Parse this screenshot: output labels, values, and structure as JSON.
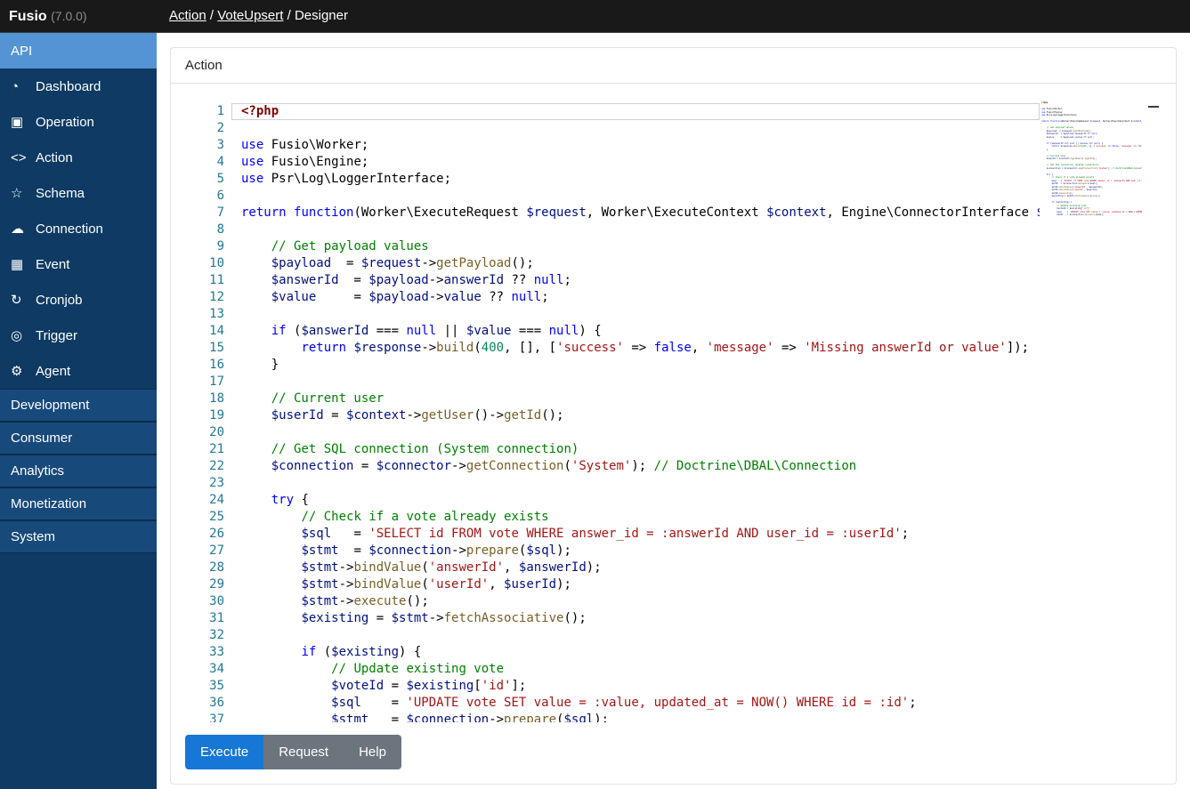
{
  "colors": {
    "c-accent": "#1677d6",
    "c-secondary": "#6c757d",
    "c-sidebar": "#0e3a63",
    "c-active": "#5494d4",
    "c-section": "#17497b"
  },
  "topbar": {
    "brand": "Fusio",
    "version": "(7.0.0)",
    "breadcrumb": [
      {
        "label": "Action",
        "link": true
      },
      {
        "label": "VoteUpsert",
        "link": true
      },
      {
        "label": "Designer",
        "link": false
      }
    ]
  },
  "sidebar": {
    "items": [
      {
        "label": "API",
        "icon": "",
        "icon_name": "",
        "active": true
      },
      {
        "label": "Dashboard",
        "icon": "◔",
        "icon_name": "dashboard-gauge-icon"
      },
      {
        "label": "Operation",
        "icon": "▣",
        "icon_name": "operation-icon"
      },
      {
        "label": "Action",
        "icon": "<>",
        "icon_name": "action-code-icon"
      },
      {
        "label": "Schema",
        "icon": "☆",
        "icon_name": "schema-star-icon"
      },
      {
        "label": "Connection",
        "icon": "☁",
        "icon_name": "connection-cloud-icon"
      },
      {
        "label": "Event",
        "icon": "▦",
        "icon_name": "event-calendar-icon"
      },
      {
        "label": "Cronjob",
        "icon": "↻",
        "icon_name": "cronjob-clock-icon"
      },
      {
        "label": "Trigger",
        "icon": "◎",
        "icon_name": "trigger-target-icon"
      },
      {
        "label": "Agent",
        "icon": "⚙",
        "icon_name": "agent-robot-icon"
      }
    ],
    "sections": [
      "Development",
      "Consumer",
      "Analytics",
      "Monetization",
      "System"
    ]
  },
  "panel": {
    "title": "Action"
  },
  "actions": {
    "execute": "Execute",
    "request": "Request",
    "help": "Help"
  },
  "editor": {
    "language": "php",
    "current_line": 1,
    "lines": [
      [
        [
          "m",
          "<?php"
        ]
      ],
      [],
      [
        [
          "k",
          "use"
        ],
        [
          "d",
          " Fusio\\Worker;"
        ]
      ],
      [
        [
          "k",
          "use"
        ],
        [
          "d",
          " Fusio\\Engine;"
        ]
      ],
      [
        [
          "k",
          "use"
        ],
        [
          "d",
          " Psr\\Log\\LoggerInterface;"
        ]
      ],
      [],
      [
        [
          "k",
          "return"
        ],
        [
          "d",
          " "
        ],
        [
          "k",
          "function"
        ],
        [
          "d",
          "(Worker\\ExecuteRequest "
        ],
        [
          "v",
          "$request"
        ],
        [
          "d",
          ", Worker\\ExecuteContext "
        ],
        [
          "v",
          "$context"
        ],
        [
          "d",
          ", Engine\\ConnectorInterface "
        ],
        [
          "v",
          "$connector"
        ],
        [
          "d",
          ", "
        ]
      ],
      [],
      [
        [
          "d",
          "    "
        ],
        [
          "c",
          "// Get payload values"
        ]
      ],
      [
        [
          "d",
          "    "
        ],
        [
          "v",
          "$payload"
        ],
        [
          "d",
          "  = "
        ],
        [
          "v",
          "$request"
        ],
        [
          "d",
          "->"
        ],
        [
          "f",
          "getPayload"
        ],
        [
          "d",
          "();"
        ]
      ],
      [
        [
          "d",
          "    "
        ],
        [
          "v",
          "$answerId"
        ],
        [
          "d",
          "  = "
        ],
        [
          "v",
          "$payload"
        ],
        [
          "d",
          "->"
        ],
        [
          "v",
          "answerId"
        ],
        [
          "d",
          " ?? "
        ],
        [
          "k",
          "null"
        ],
        [
          "d",
          ";"
        ]
      ],
      [
        [
          "d",
          "    "
        ],
        [
          "v",
          "$value"
        ],
        [
          "d",
          "     = "
        ],
        [
          "v",
          "$payload"
        ],
        [
          "d",
          "->"
        ],
        [
          "v",
          "value"
        ],
        [
          "d",
          " ?? "
        ],
        [
          "k",
          "null"
        ],
        [
          "d",
          ";"
        ]
      ],
      [],
      [
        [
          "d",
          "    "
        ],
        [
          "k",
          "if"
        ],
        [
          "d",
          " ("
        ],
        [
          "v",
          "$answerId"
        ],
        [
          "d",
          " === "
        ],
        [
          "k",
          "null"
        ],
        [
          "d",
          " || "
        ],
        [
          "v",
          "$value"
        ],
        [
          "d",
          " === "
        ],
        [
          "k",
          "null"
        ],
        [
          "d",
          ") {"
        ]
      ],
      [
        [
          "d",
          "        "
        ],
        [
          "k",
          "return"
        ],
        [
          "d",
          " "
        ],
        [
          "v",
          "$response"
        ],
        [
          "d",
          "->"
        ],
        [
          "f",
          "build"
        ],
        [
          "d",
          "("
        ],
        [
          "n",
          "400"
        ],
        [
          "d",
          ", [], ["
        ],
        [
          "s",
          "'success'"
        ],
        [
          "d",
          " => "
        ],
        [
          "k",
          "false"
        ],
        [
          "d",
          ", "
        ],
        [
          "s",
          "'message'"
        ],
        [
          "d",
          " => "
        ],
        [
          "s",
          "'Missing answerId or value'"
        ],
        [
          "d",
          "]);"
        ]
      ],
      [
        [
          "d",
          "    }"
        ]
      ],
      [],
      [
        [
          "d",
          "    "
        ],
        [
          "c",
          "// Current user"
        ]
      ],
      [
        [
          "d",
          "    "
        ],
        [
          "v",
          "$userId"
        ],
        [
          "d",
          " = "
        ],
        [
          "v",
          "$context"
        ],
        [
          "d",
          "->"
        ],
        [
          "f",
          "getUser"
        ],
        [
          "d",
          "()->"
        ],
        [
          "f",
          "getId"
        ],
        [
          "d",
          "();"
        ]
      ],
      [],
      [
        [
          "d",
          "    "
        ],
        [
          "c",
          "// Get SQL connection (System connection)"
        ]
      ],
      [
        [
          "d",
          "    "
        ],
        [
          "v",
          "$connection"
        ],
        [
          "d",
          " = "
        ],
        [
          "v",
          "$connector"
        ],
        [
          "d",
          "->"
        ],
        [
          "f",
          "getConnection"
        ],
        [
          "d",
          "("
        ],
        [
          "s",
          "'System'"
        ],
        [
          "d",
          "); "
        ],
        [
          "c",
          "// Doctrine\\DBAL\\Connection"
        ]
      ],
      [],
      [
        [
          "d",
          "    "
        ],
        [
          "k",
          "try"
        ],
        [
          "d",
          " {"
        ]
      ],
      [
        [
          "d",
          "        "
        ],
        [
          "c",
          "// Check if a vote already exists"
        ]
      ],
      [
        [
          "d",
          "        "
        ],
        [
          "v",
          "$sql"
        ],
        [
          "d",
          "   = "
        ],
        [
          "s",
          "'SELECT id FROM vote WHERE answer_id = :answerId AND user_id = :userId'"
        ],
        [
          "d",
          ";"
        ]
      ],
      [
        [
          "d",
          "        "
        ],
        [
          "v",
          "$stmt"
        ],
        [
          "d",
          "  = "
        ],
        [
          "v",
          "$connection"
        ],
        [
          "d",
          "->"
        ],
        [
          "f",
          "prepare"
        ],
        [
          "d",
          "("
        ],
        [
          "v",
          "$sql"
        ],
        [
          "d",
          ");"
        ]
      ],
      [
        [
          "d",
          "        "
        ],
        [
          "v",
          "$stmt"
        ],
        [
          "d",
          "->"
        ],
        [
          "f",
          "bindValue"
        ],
        [
          "d",
          "("
        ],
        [
          "s",
          "'answerId'"
        ],
        [
          "d",
          ", "
        ],
        [
          "v",
          "$answerId"
        ],
        [
          "d",
          ");"
        ]
      ],
      [
        [
          "d",
          "        "
        ],
        [
          "v",
          "$stmt"
        ],
        [
          "d",
          "->"
        ],
        [
          "f",
          "bindValue"
        ],
        [
          "d",
          "("
        ],
        [
          "s",
          "'userId'"
        ],
        [
          "d",
          ", "
        ],
        [
          "v",
          "$userId"
        ],
        [
          "d",
          ");"
        ]
      ],
      [
        [
          "d",
          "        "
        ],
        [
          "v",
          "$stmt"
        ],
        [
          "d",
          "->"
        ],
        [
          "f",
          "execute"
        ],
        [
          "d",
          "();"
        ]
      ],
      [
        [
          "d",
          "        "
        ],
        [
          "v",
          "$existing"
        ],
        [
          "d",
          " = "
        ],
        [
          "v",
          "$stmt"
        ],
        [
          "d",
          "->"
        ],
        [
          "f",
          "fetchAssociative"
        ],
        [
          "d",
          "();"
        ]
      ],
      [],
      [
        [
          "d",
          "        "
        ],
        [
          "k",
          "if"
        ],
        [
          "d",
          " ("
        ],
        [
          "v",
          "$existing"
        ],
        [
          "d",
          ") {"
        ]
      ],
      [
        [
          "d",
          "            "
        ],
        [
          "c",
          "// Update existing vote"
        ]
      ],
      [
        [
          "d",
          "            "
        ],
        [
          "v",
          "$voteId"
        ],
        [
          "d",
          " = "
        ],
        [
          "v",
          "$existing"
        ],
        [
          "d",
          "["
        ],
        [
          "s",
          "'id'"
        ],
        [
          "d",
          "];"
        ]
      ],
      [
        [
          "d",
          "            "
        ],
        [
          "v",
          "$sql"
        ],
        [
          "d",
          "    = "
        ],
        [
          "s",
          "'UPDATE vote SET value = :value, updated_at = NOW() WHERE id = :id'"
        ],
        [
          "d",
          ";"
        ]
      ],
      [
        [
          "d",
          "            "
        ],
        [
          "v",
          "$stmt"
        ],
        [
          "d",
          "   = "
        ],
        [
          "v",
          "$connection"
        ],
        [
          "d",
          "->"
        ],
        [
          "f",
          "prepare"
        ],
        [
          "d",
          "("
        ],
        [
          "v",
          "$sql"
        ],
        [
          "d",
          ");"
        ]
      ]
    ]
  }
}
